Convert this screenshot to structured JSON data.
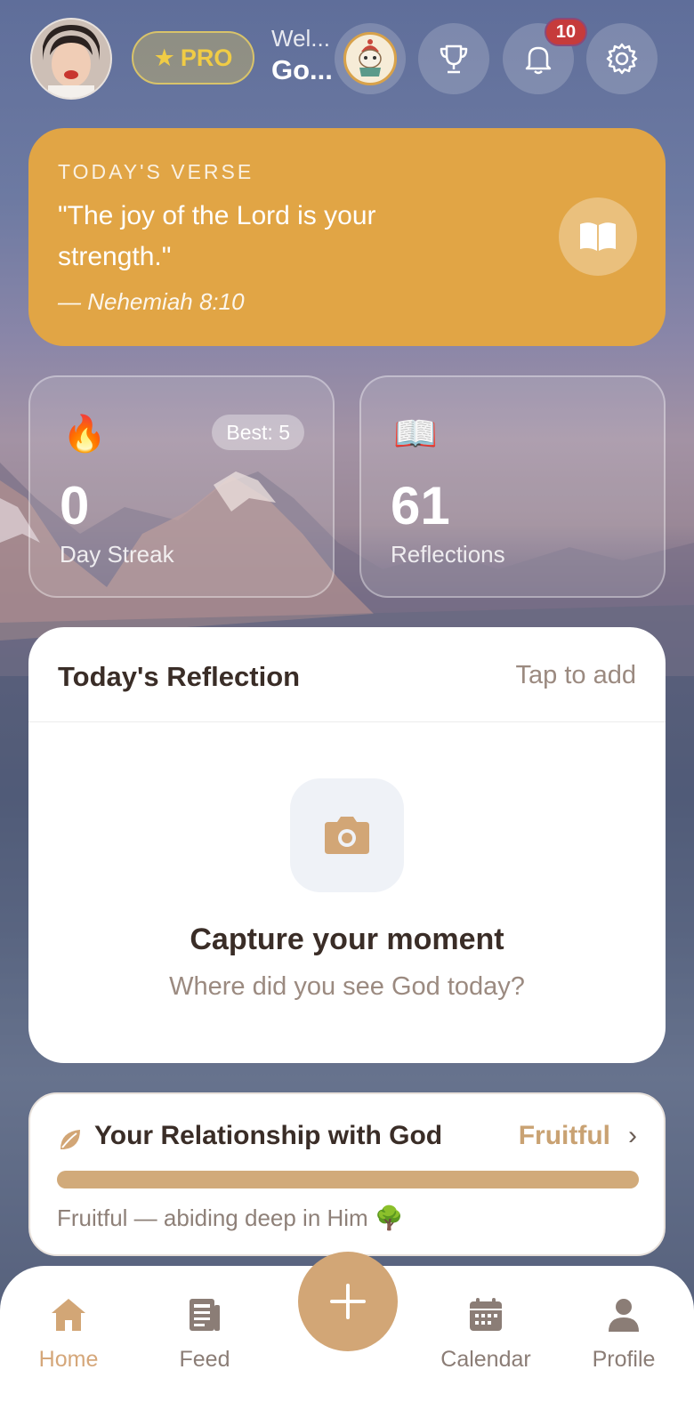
{
  "header": {
    "pro_label": "PRO",
    "welcome_line1": "Wel...",
    "welcome_line2": "Go...",
    "notification_count": "10"
  },
  "verse": {
    "label": "TODAY'S VERSE",
    "text": "\"The joy of the Lord is your strength.\"",
    "reference": "— Nehemiah 8:10"
  },
  "stats": {
    "streak": {
      "best_label": "Best: 5",
      "value": "0",
      "caption": "Day Streak"
    },
    "reflections": {
      "value": "61",
      "caption": "Reflections"
    }
  },
  "reflection": {
    "title": "Today's Reflection",
    "action": "Tap to add",
    "prompt_title": "Capture your moment",
    "prompt_sub": "Where did you see God today?"
  },
  "relationship": {
    "title": "Your Relationship with God",
    "status": "Fruitful",
    "description": "Fruitful — abiding deep in Him 🌳",
    "progress": 1.0
  },
  "nav": {
    "items": [
      {
        "label": "Home"
      },
      {
        "label": "Feed"
      },
      {
        "label": "Calendar"
      },
      {
        "label": "Profile"
      }
    ]
  },
  "colors": {
    "accent": "#d2a676",
    "verse_card": "#e1a545",
    "pro": "#f0cc45",
    "badge": "#c63b3b"
  }
}
